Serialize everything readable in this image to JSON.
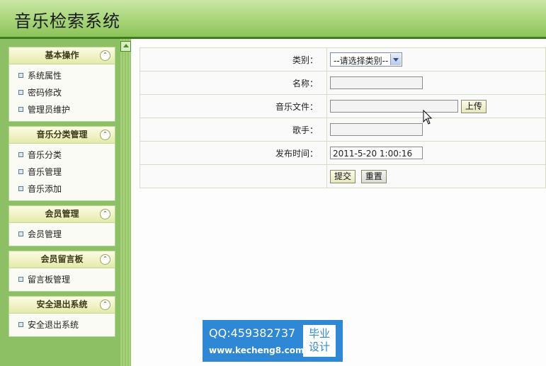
{
  "header": {
    "title": "音乐检索系统"
  },
  "sidebar": {
    "panels": [
      {
        "title": "基本操作",
        "items": [
          "系统属性",
          "密码修改",
          "管理员维护"
        ]
      },
      {
        "title": "音乐分类管理",
        "items": [
          "音乐分类",
          "音乐管理",
          "音乐添加"
        ]
      },
      {
        "title": "会员管理",
        "items": [
          "会员管理"
        ]
      },
      {
        "title": "会员留言板",
        "items": [
          "留言板管理"
        ]
      },
      {
        "title": "安全退出系统",
        "items": [
          "安全退出系统"
        ]
      }
    ],
    "collapse_glyph": "⌃"
  },
  "form": {
    "category_label": "类别：",
    "category_selected": "--请选择类别--",
    "name_label": "名称：",
    "name_value": "",
    "file_label": "音乐文件：",
    "file_value": "",
    "upload_label": "上传",
    "singer_label": "歌手：",
    "singer_value": "",
    "date_label": "发布时间：",
    "date_value": "2011-5-20 1:00:16",
    "submit_label": "提交",
    "reset_label": "重置"
  },
  "watermark": {
    "qq": "QQ:459382737",
    "url": "www.kecheng8.com",
    "badge_line1": "毕业",
    "badge_line2": "设计"
  }
}
